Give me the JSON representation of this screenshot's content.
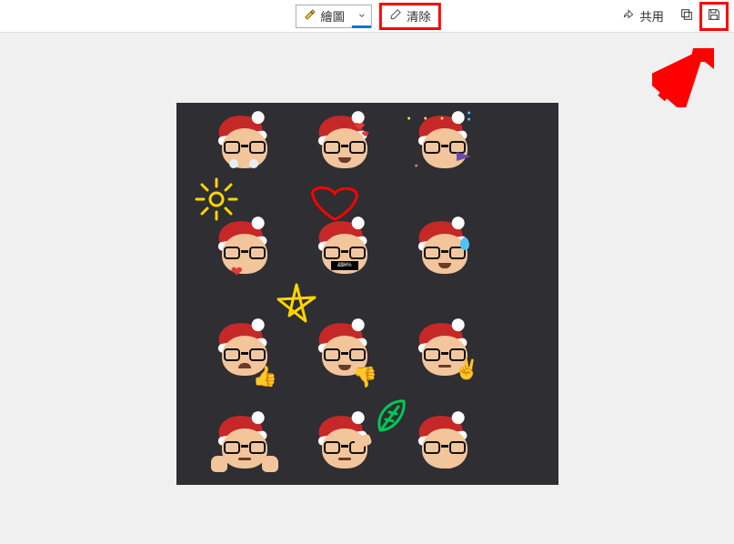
{
  "toolbar": {
    "draw_label": "繪圖",
    "clear_label": "清除",
    "share_label": "共用",
    "censor_text": "&$!#%"
  },
  "annotations": {
    "clear_highlighted": true,
    "save_highlighted": true,
    "arrow_color": "#ff0000"
  },
  "image": {
    "background": "#2e2e33",
    "hat_color": "#c62828",
    "skin": "#f2c59b",
    "rows": 4,
    "cols": 3,
    "doodles": [
      {
        "type": "sun",
        "color": "#ffd600"
      },
      {
        "type": "heart_outline",
        "color": "#ff0000"
      },
      {
        "type": "star",
        "color": "#ffd600"
      },
      {
        "type": "leaf",
        "color": "#00c853"
      }
    ]
  }
}
